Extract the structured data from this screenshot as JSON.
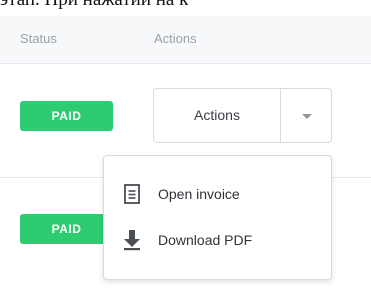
{
  "top_text": "этап. При нажатии на к",
  "table": {
    "headers": {
      "status": "Status",
      "actions": "Actions"
    },
    "rows": [
      {
        "status": "PAID"
      },
      {
        "status": "PAID"
      }
    ]
  },
  "actions_button": {
    "label": "Actions"
  },
  "dropdown": {
    "items": [
      {
        "label": "Open invoice",
        "icon": "document-icon"
      },
      {
        "label": "Download PDF",
        "icon": "download-icon"
      }
    ]
  },
  "colors": {
    "paid_badge": "#2ecc71",
    "header_bg": "#f7f8fa",
    "header_text": "#9aa1aa",
    "border": "#d7dbe0"
  }
}
